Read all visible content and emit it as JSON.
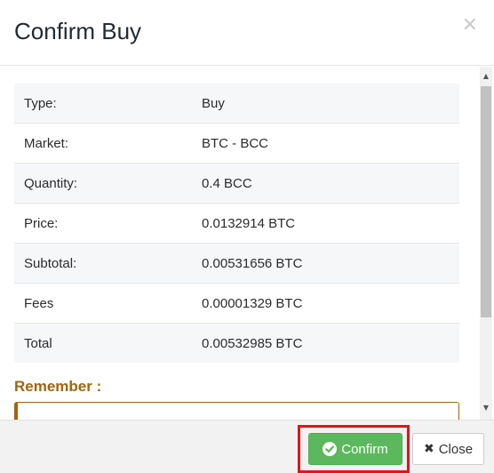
{
  "modal": {
    "title": "Confirm Buy",
    "close_x": "×"
  },
  "details": [
    {
      "label": "Type:",
      "value": "Buy"
    },
    {
      "label": "Market:",
      "value": "BTC - BCC"
    },
    {
      "label": "Quantity:",
      "value": "0.4 BCC"
    },
    {
      "label": "Price:",
      "value": "0.0132914 BTC"
    },
    {
      "label": "Subtotal:",
      "value": "0.00531656 BTC"
    },
    {
      "label": "Fees",
      "value": "0.00001329 BTC"
    },
    {
      "label": "Total",
      "value": "0.00532985 BTC"
    }
  ],
  "remember": {
    "label": "Remember :"
  },
  "footer": {
    "confirm_label": "Confirm",
    "close_label": "Close",
    "confirm_icon": "check-circle-icon",
    "close_icon": "times-icon"
  },
  "colors": {
    "confirm_button": "#5cb85c",
    "highlight_border": "#e1141b",
    "remember_accent": "#a0650e"
  }
}
